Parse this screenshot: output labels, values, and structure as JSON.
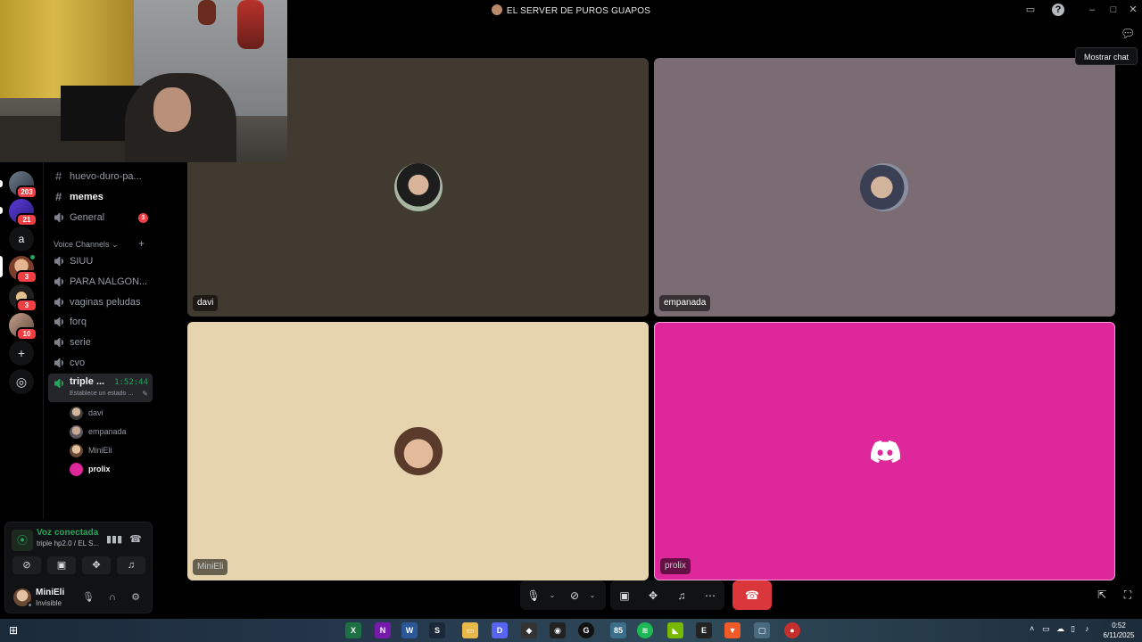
{
  "window": {
    "title": "EL SERVER DE PUROS GUAPOS"
  },
  "servers": [
    {
      "name": "server-1",
      "badge": "203"
    },
    {
      "name": "server-2",
      "badge": "21"
    },
    {
      "name": "server-a",
      "letter": "a"
    },
    {
      "name": "server-3",
      "badge": "3"
    },
    {
      "name": "server-4",
      "badge": "3"
    },
    {
      "name": "server-5",
      "badge": "10"
    }
  ],
  "channels": {
    "text": [
      {
        "label": "huevo-duro-pa...",
        "bold": false
      },
      {
        "label": "memes",
        "bold": true
      }
    ],
    "general": {
      "label": "General",
      "badge": "3"
    },
    "voice_category": "Voice Channels",
    "voice": [
      "SIUU",
      "PARA NALGON...",
      "vaginas peludas",
      "forq",
      "serie",
      "cvo"
    ],
    "active_voice": {
      "name": "triple ...",
      "timer": "1:52:44",
      "status": "Establece un estado ..."
    },
    "members": [
      "davi",
      "empanada",
      "MiniEli",
      "prolix"
    ]
  },
  "voice_panel": {
    "title": "Voz conectada",
    "subtitle": "triple hp2.0 / EL S..."
  },
  "user": {
    "name": "MiniEli",
    "status": "Invisible"
  },
  "tiles": [
    {
      "name": "davi",
      "bg": "#403a30"
    },
    {
      "name": "empanada",
      "bg": "#7a6c72"
    },
    {
      "name": "MiniEli",
      "bg": "#e5d4ae"
    },
    {
      "name": "prolix",
      "bg": "#df279c"
    }
  ],
  "tooltip": {
    "chat": "Mostrar chat"
  },
  "taskbar": {
    "time": "0:52",
    "date": "6/11/2025",
    "badge": "85"
  },
  "colors": {
    "accent_green": "#23a55a",
    "hangup_red": "#da373c",
    "badge_red": "#f23f43"
  }
}
